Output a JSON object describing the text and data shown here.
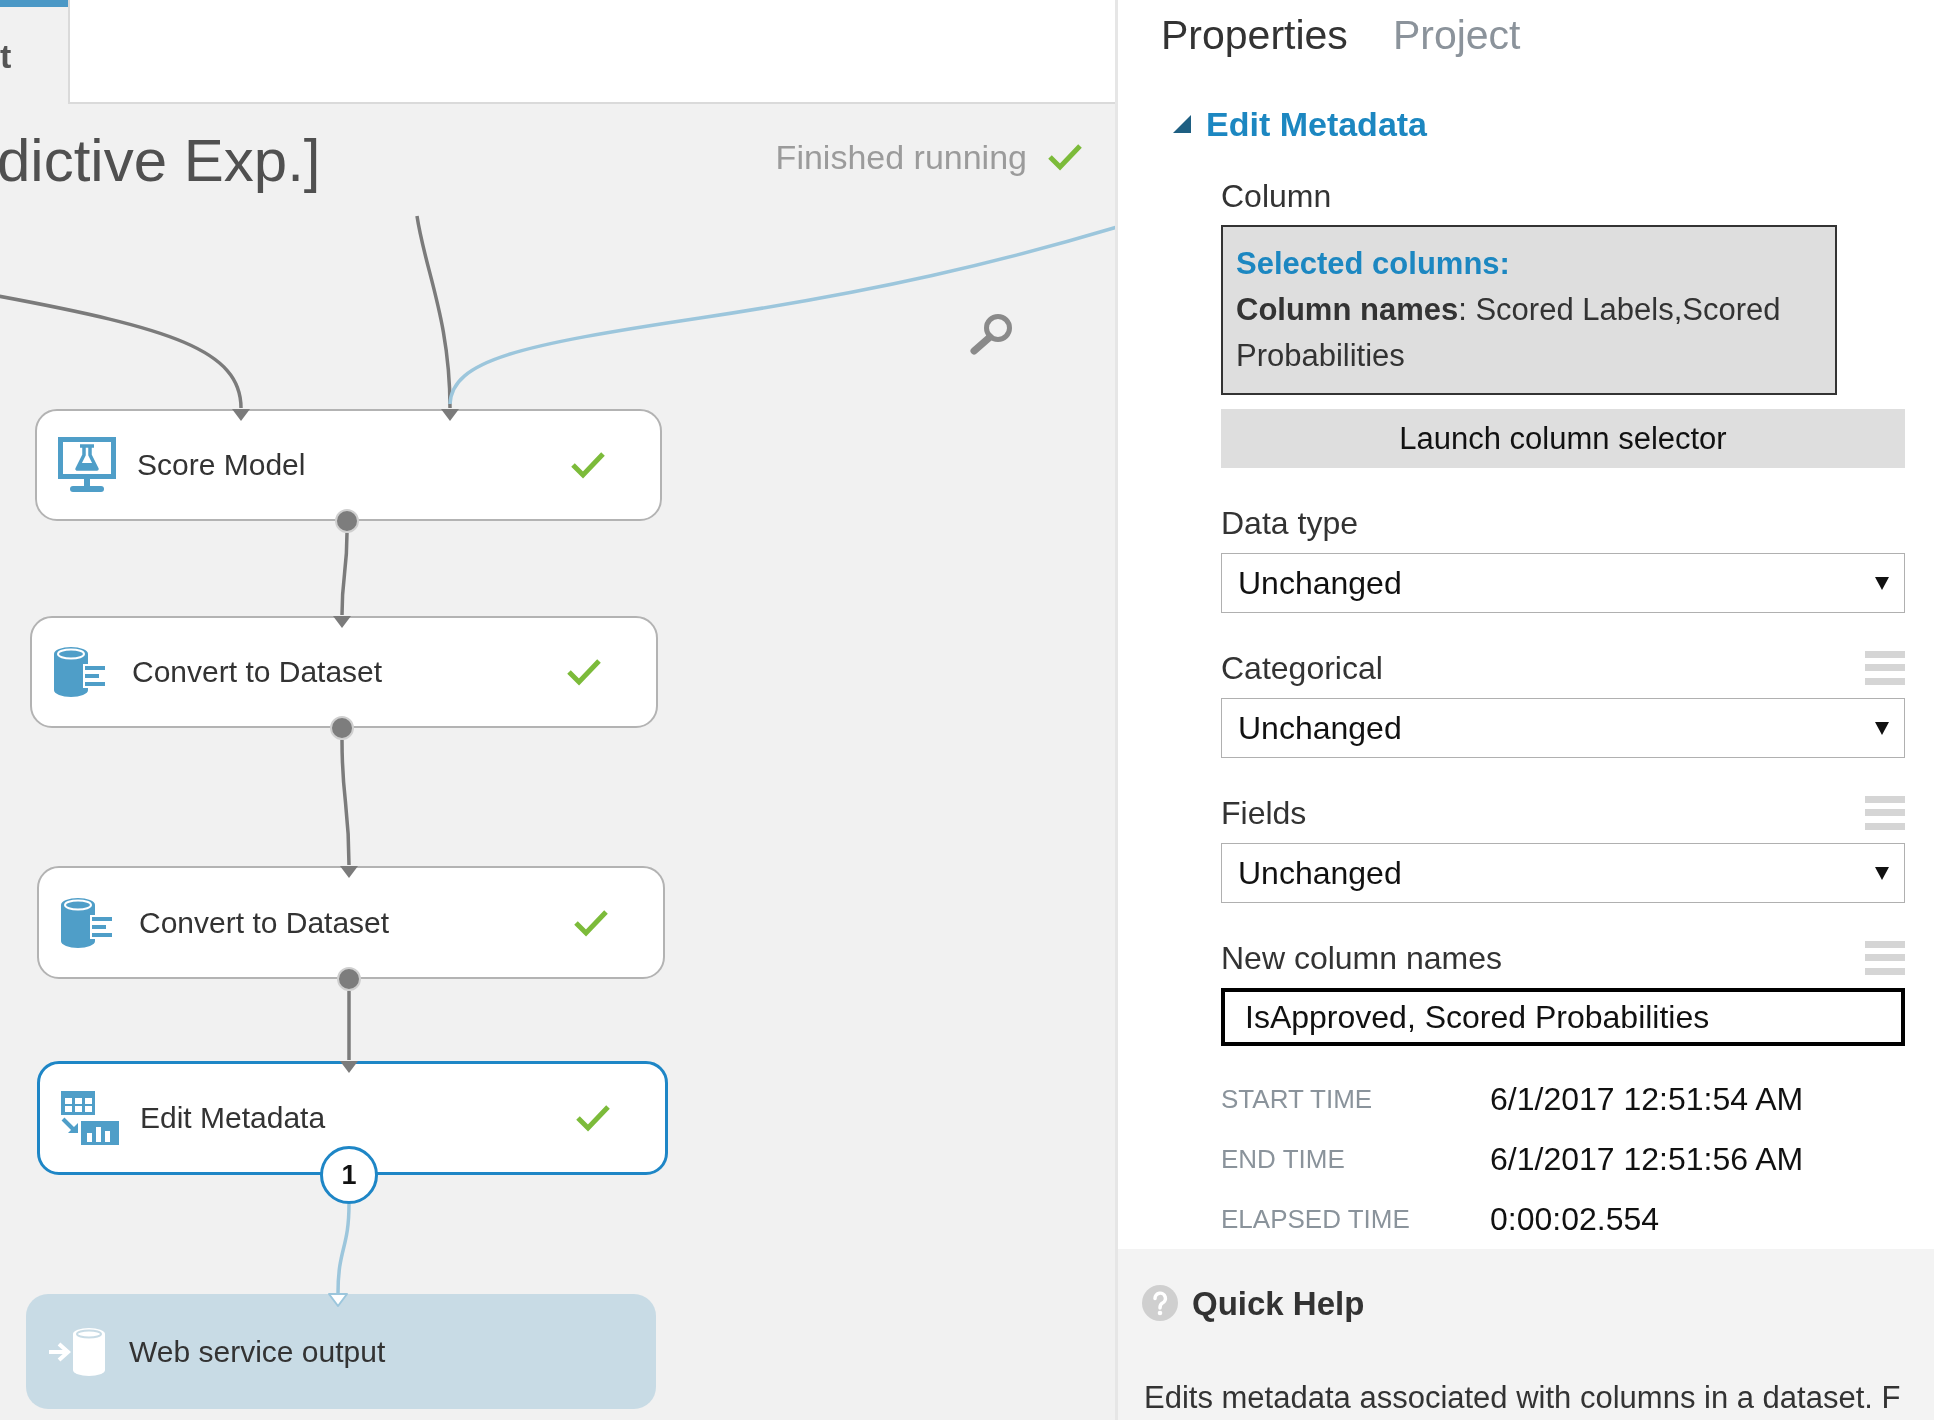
{
  "tabs": [
    {
      "label": "t",
      "selected": true
    }
  ],
  "experiment": {
    "title": "dictive Exp.]",
    "status": "Finished running",
    "finished": true
  },
  "canvas": {
    "modules": [
      {
        "kind": "score",
        "label": "Score Model",
        "finished": true,
        "selected": false
      },
      {
        "kind": "convert",
        "label": "Convert to Dataset",
        "finished": true,
        "selected": false
      },
      {
        "kind": "convert",
        "label": "Convert to Dataset",
        "finished": true,
        "selected": false
      },
      {
        "kind": "edit",
        "label": "Edit Metadata",
        "finished": true,
        "selected": true,
        "badge": "1"
      }
    ],
    "output": {
      "label": "Web service output"
    }
  },
  "properties": {
    "tabs": [
      {
        "label": "Properties",
        "selected": true
      },
      {
        "label": "Project",
        "selected": false
      }
    ],
    "section": {
      "title": "Edit Metadata",
      "expanded": true
    },
    "column": {
      "label": "Column",
      "heading": "Selected columns:",
      "text": "**Column names**: Scored Labels,Scored Probabilities"
    },
    "launch_button": "Launch column selector",
    "fields": [
      {
        "kind": "select",
        "label": "Data type",
        "value": "Unchanged",
        "handle": false,
        "focused": false
      },
      {
        "kind": "select",
        "label": "Categorical",
        "value": "Unchanged",
        "handle": true,
        "focused": false
      },
      {
        "kind": "select",
        "label": "Fields",
        "value": "Unchanged",
        "handle": true,
        "focused": false
      },
      {
        "kind": "text",
        "label": "New column names",
        "value": "IsApproved, Scored Probabilities",
        "handle": true,
        "focused": true
      }
    ],
    "run_info": [
      {
        "label": "START TIME",
        "value": "6/1/2017 12:51:54 AM"
      },
      {
        "label": "END TIME",
        "value": "6/1/2017 12:51:56 AM"
      },
      {
        "label": "ELAPSED TIME",
        "value": "0:00:02.554"
      }
    ]
  },
  "quick_help": {
    "title": "Quick Help",
    "text": "Edits metadata associated with columns in a dataset. F"
  }
}
